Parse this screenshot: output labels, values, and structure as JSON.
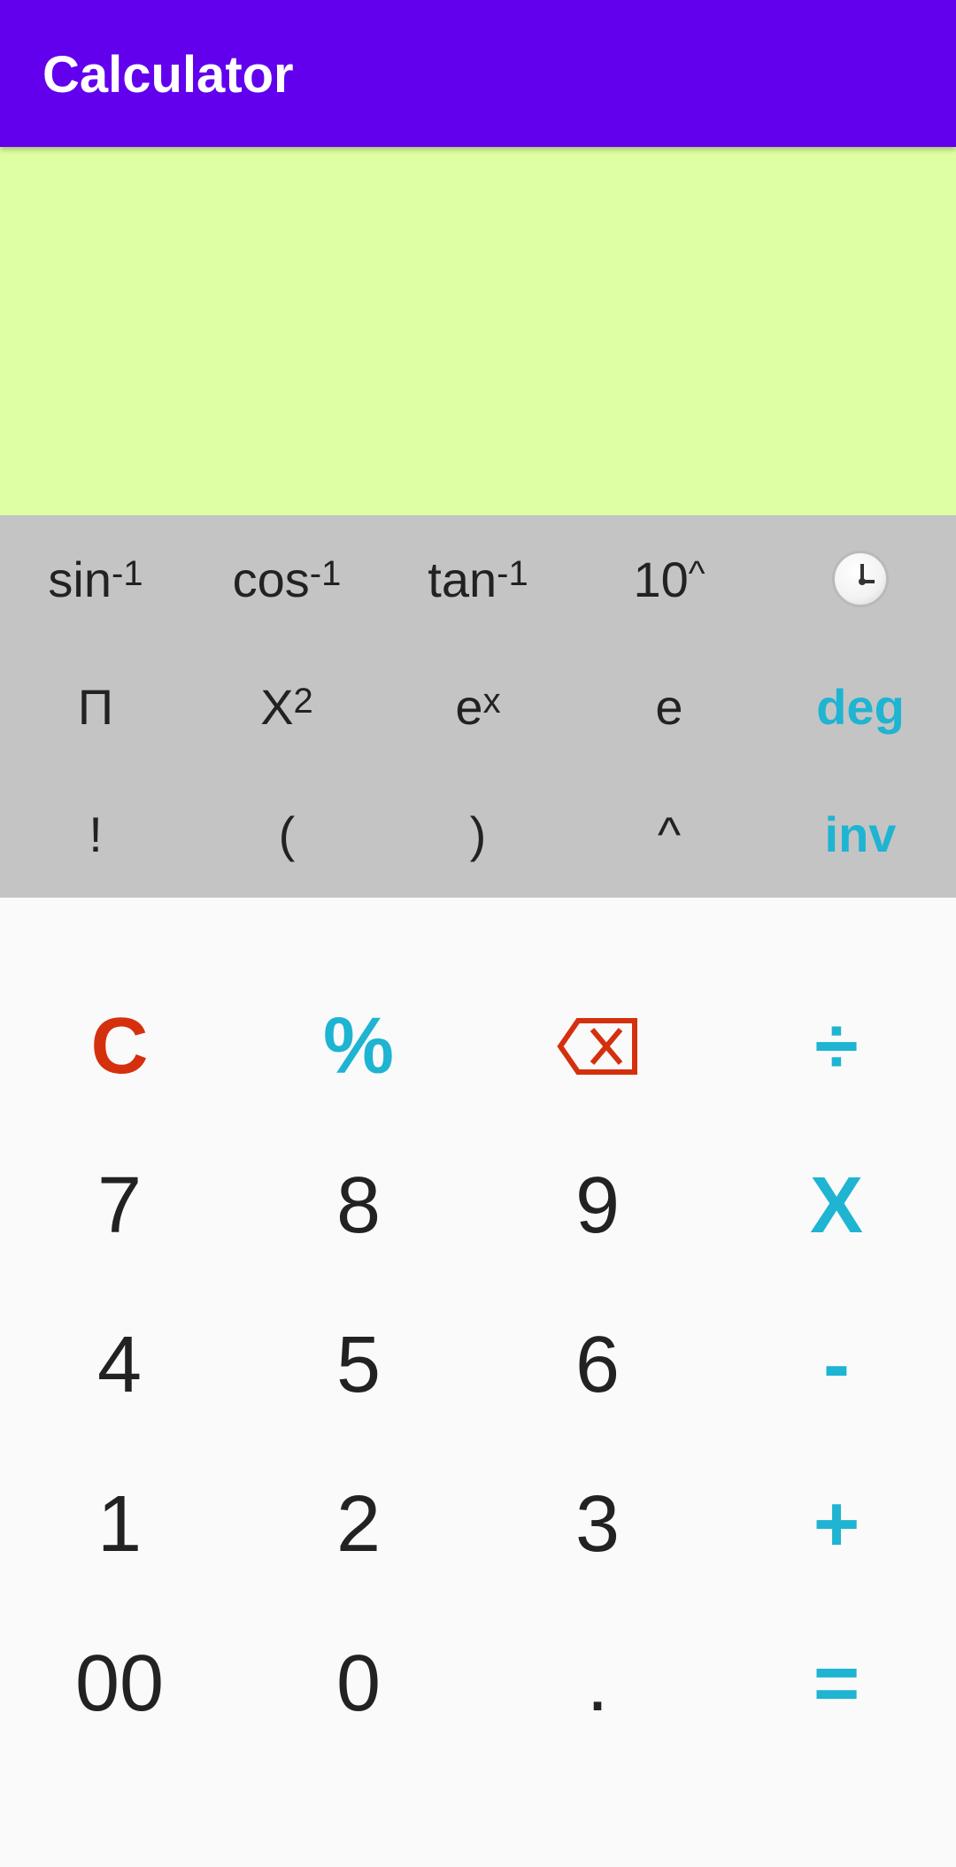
{
  "app": {
    "title": "Calculator"
  },
  "display": {
    "expression": "",
    "result": ""
  },
  "colors": {
    "appbar": "#6200ee",
    "display_bg": "#deffa2",
    "sci_panel_bg": "#c4c4c4",
    "keypad_bg": "#fafafa",
    "accent": "#1eb4d2",
    "danger": "#d5300e",
    "text": "#222222"
  },
  "scientific": {
    "row1": [
      {
        "base": "sin",
        "sup": "-1"
      },
      {
        "base": "cos",
        "sup": "-1"
      },
      {
        "base": "tan",
        "sup": "-1"
      },
      {
        "base": "10",
        "sup": "^"
      },
      {
        "icon": "history-clock-icon"
      }
    ],
    "row2": [
      {
        "base": "Π"
      },
      {
        "base": "X",
        "sup": "2"
      },
      {
        "base": "e",
        "sup": "x"
      },
      {
        "base": "e"
      },
      {
        "base": "deg"
      }
    ],
    "row3": [
      {
        "base": "!"
      },
      {
        "base": "("
      },
      {
        "base": ")"
      },
      {
        "base": "^"
      },
      {
        "base": "inv"
      }
    ]
  },
  "keypad": {
    "row1": [
      "C",
      "%",
      "⌫",
      "÷"
    ],
    "row2": [
      "7",
      "8",
      "9",
      "X"
    ],
    "row3": [
      "4",
      "5",
      "6",
      "-"
    ],
    "row4": [
      "1",
      "2",
      "3",
      "+"
    ],
    "row5": [
      "00",
      "0",
      ".",
      "="
    ]
  }
}
